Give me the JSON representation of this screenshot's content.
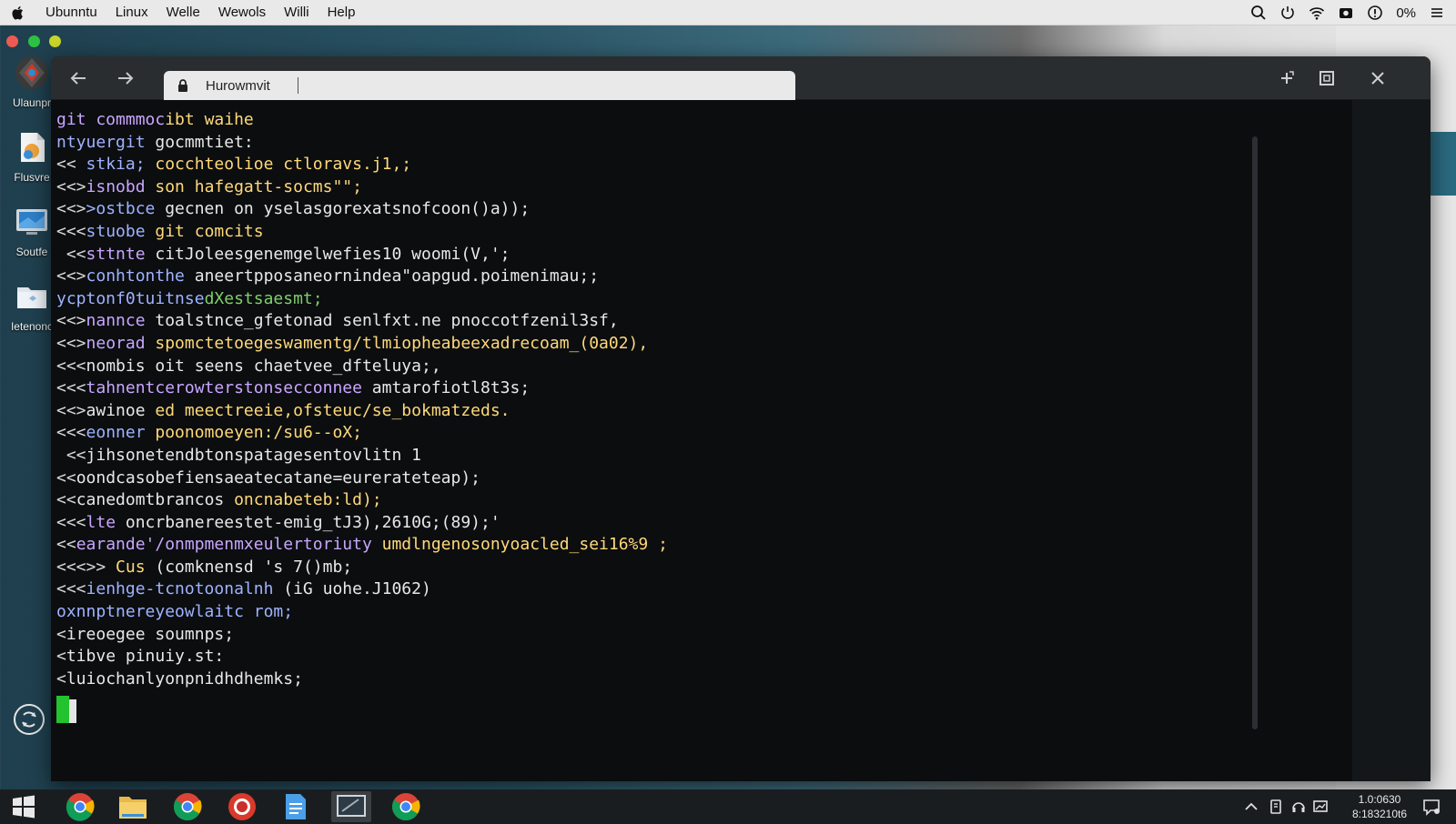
{
  "menubar": {
    "items": [
      "Ubunntu",
      "Linux",
      "Welle",
      "Wewols",
      "Willi",
      "Help"
    ],
    "battery": "0%"
  },
  "desktop": {
    "icons": [
      {
        "label": "Ulaunpr"
      },
      {
        "label": "Flusvre"
      },
      {
        "label": "Soutfe"
      },
      {
        "label": "Ietenonc"
      }
    ]
  },
  "window": {
    "tab_title": "Hurowmvit"
  },
  "terminal": {
    "colors": {
      "violet": "#c9a6ff",
      "blue": "#9fb3ff",
      "yellow": "#ffd97a",
      "white": "#e8e8e8",
      "green": "#7fcf6b",
      "pink": "#ff8fd0"
    },
    "lines": [
      {
        "prefix": "",
        "cmd": "git commmoc",
        "cmd_color": "#c9a6ff",
        "rest": "ibt waihe",
        "rest_color": "#ffd97a"
      },
      {
        "prefix": "",
        "cmd": "ntyuergit",
        "cmd_color": "#9fb3ff",
        "rest": " gocmmtiet:",
        "rest_color": "#e8e8e8"
      },
      {
        "prefix": "<< ",
        "cmd": "stkia;",
        "cmd_color": "#9fb3ff",
        "rest": " cocchteolioe ctloravs.j1,;",
        "rest_color": "#ffd97a"
      },
      {
        "prefix": "<<>",
        "cmd": "isnobd",
        "cmd_color": "#c9a6ff",
        "rest": " son hafegatt-socms\"\";",
        "rest_color": "#ffd97a"
      },
      {
        "prefix": "<<>",
        "cmd": ">ostbce",
        "cmd_color": "#9fb3ff",
        "rest": " gecnen on yselasgorexatsnofcoon()a));",
        "rest_color": "#e8e8e8"
      },
      {
        "prefix": "<<<",
        "cmd": "stuobe",
        "cmd_color": "#9fb3ff",
        "rest": " git comcits",
        "rest_color": "#ffd97a"
      },
      {
        "prefix": " <<",
        "cmd": "sttnte",
        "cmd_color": "#c9a6ff",
        "rest": " citJoleesgenemgelwefies10 woomi(V,';",
        "rest_color": "#e8e8e8"
      },
      {
        "prefix": "<<>",
        "cmd": "conhtonthe",
        "cmd_color": "#9fb3ff",
        "rest": " aneertpposaneornindea\"oapgud.poimenimau;;",
        "rest_color": "#e8e8e8"
      },
      {
        "prefix": "",
        "cmd": "ycptonf0tuitnse",
        "cmd_color": "#9fb3ff",
        "rest": "dXestsaesmt;",
        "rest_color": "#7fcf6b"
      },
      {
        "prefix": "<<>",
        "cmd": "nannce",
        "cmd_color": "#c9a6ff",
        "rest": " toalstnce_gfetonad senlfxt.ne pnoccotfzenil3sf,",
        "rest_color": "#e8e8e8"
      },
      {
        "prefix": "<<>",
        "cmd": "neorad",
        "cmd_color": "#c9a6ff",
        "rest": " spomctetoegeswamentg/tlmiopheabeexadrecoam_(0a02),",
        "rest_color": "#ffd97a"
      },
      {
        "prefix": "<<<",
        "cmd": "nombis",
        "cmd_color": "#e8e8e8",
        "rest": " oit seens chaetvee_dfteluya;,",
        "rest_color": "#e8e8e8"
      },
      {
        "prefix": "<<<",
        "cmd": "tahnentcerowterstonsecconnee",
        "cmd_color": "#c9a6ff",
        "rest": " amtarofiotl8t3s;",
        "rest_color": "#e8e8e8"
      },
      {
        "prefix": "<<>",
        "cmd": "awinoe",
        "cmd_color": "#e8e8e8",
        "rest": " ed meectreeie,ofsteuc/se_bokmatzeds.",
        "rest_color": "#ffd97a"
      },
      {
        "prefix": "<<<",
        "cmd": "eonner",
        "cmd_color": "#9fb3ff",
        "rest": " poonomoeyen:/su6--oX;",
        "rest_color": "#ffd97a"
      },
      {
        "prefix": " <<",
        "cmd": "jihsonetendbtonspatagesentovlitn 1",
        "cmd_color": "#e8e8e8",
        "rest": "",
        "rest_color": "#e8e8e8"
      },
      {
        "prefix": "<<",
        "cmd": "oondcasobefiensaeatecatane=eurerateteap",
        "cmd_color": "#e8e8e8",
        "rest": ");",
        "rest_color": "#e8e8e8"
      },
      {
        "prefix": "<<",
        "cmd": "canedomtbrancos",
        "cmd_color": "#e8e8e8",
        "rest": " oncnabeteb:ld);",
        "rest_color": "#ffd97a"
      },
      {
        "prefix": "<<<",
        "cmd": "lte",
        "cmd_color": "#c9a6ff",
        "rest": " oncrbanereestet-emig_tJ3),2610G;(89);'",
        "rest_color": "#e8e8e8"
      },
      {
        "prefix": "<<",
        "cmd": "earande'/onmpmenmxeulertoriuty",
        "cmd_color": "#c9a6ff",
        "rest": " umdlngenosonyoacled_sei16%9 ;",
        "rest_color": "#ffd97a"
      },
      {
        "prefix": "<<<>> ",
        "cmd": "Cus",
        "cmd_color": "#ffd97a",
        "rest": " (comknensd 's 7()mb;",
        "rest_color": "#e8e8e8"
      },
      {
        "prefix": "<<<",
        "cmd": "ienhge-tcnotoonalnh",
        "cmd_color": "#9fb3ff",
        "rest": " (iG uohe.J1062)",
        "rest_color": "#e8e8e8"
      },
      {
        "prefix": "",
        "cmd": "oxnnptnereyeowlaitc",
        "cmd_color": "#9fb3ff",
        "rest": " rom;",
        "rest_color": "#9fb3ff"
      },
      {
        "prefix": "<",
        "cmd": "ireoegee",
        "cmd_color": "#e8e8e8",
        "rest": " soumnps;",
        "rest_color": "#e8e8e8"
      },
      {
        "prefix": "<",
        "cmd": "tibve",
        "cmd_color": "#e8e8e8",
        "rest": " pinuiy.st:",
        "rest_color": "#e8e8e8"
      },
      {
        "prefix": "<",
        "cmd": "luiochanlyonpnidhdhemks",
        "cmd_color": "#e8e8e8",
        "rest": ";",
        "rest_color": "#e8e8e8"
      }
    ]
  },
  "taskbar": {
    "clock_time": "1.0:0630",
    "clock_date": "8:183210t6"
  }
}
